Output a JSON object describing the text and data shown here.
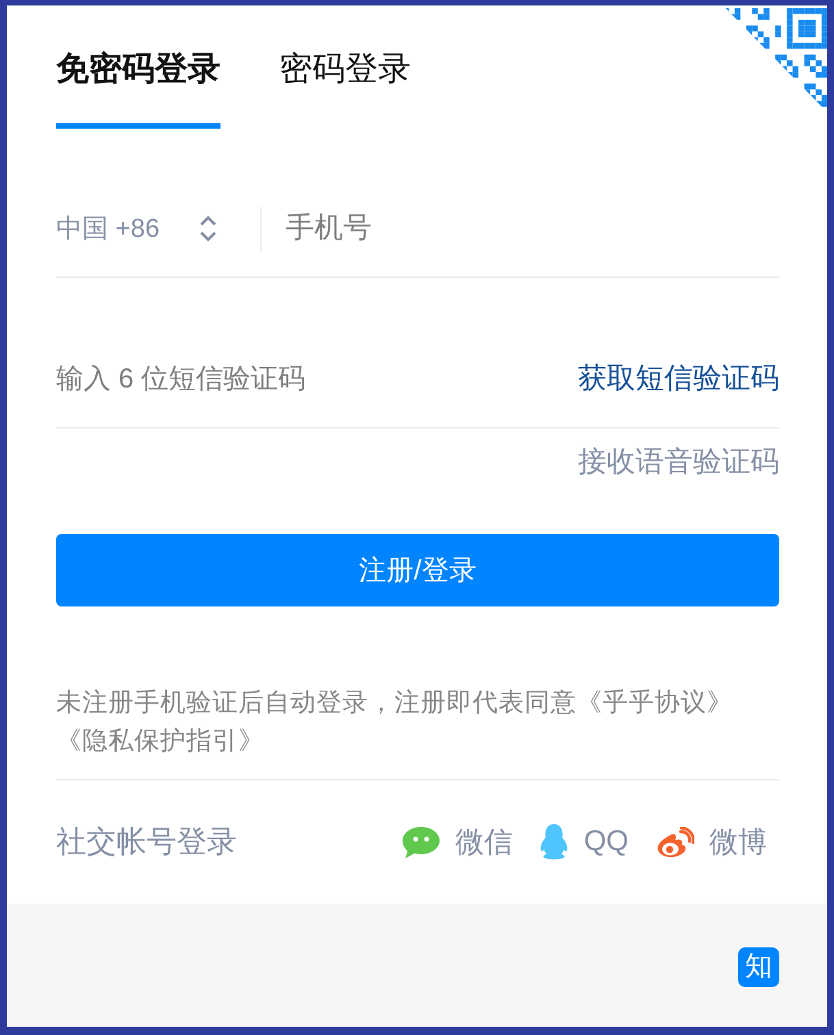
{
  "tabs": [
    {
      "label": "免密码登录",
      "selected": true
    },
    {
      "label": "密码登录",
      "selected": false
    }
  ],
  "phone": {
    "country_code": "中国 +86",
    "placeholder": "手机号"
  },
  "sms_code": {
    "placeholder": "输入 6 位短信验证码",
    "action": "获取短信验证码"
  },
  "voice_code_link": "接收语音验证码",
  "submit_button": "注册/登录",
  "terms": {
    "text": "未注册手机验证后自动登录，注册即代表同意",
    "links": [
      "《乎乎协议》",
      "《隐私保护指引》"
    ]
  },
  "social_login": {
    "label": "社交帐号登录",
    "providers": [
      {
        "kind": "wechat",
        "label": "微信"
      },
      {
        "kind": "qq",
        "label": "QQ"
      },
      {
        "kind": "weibo",
        "label": "微博"
      }
    ]
  },
  "footer": {
    "logo": "知"
  }
}
